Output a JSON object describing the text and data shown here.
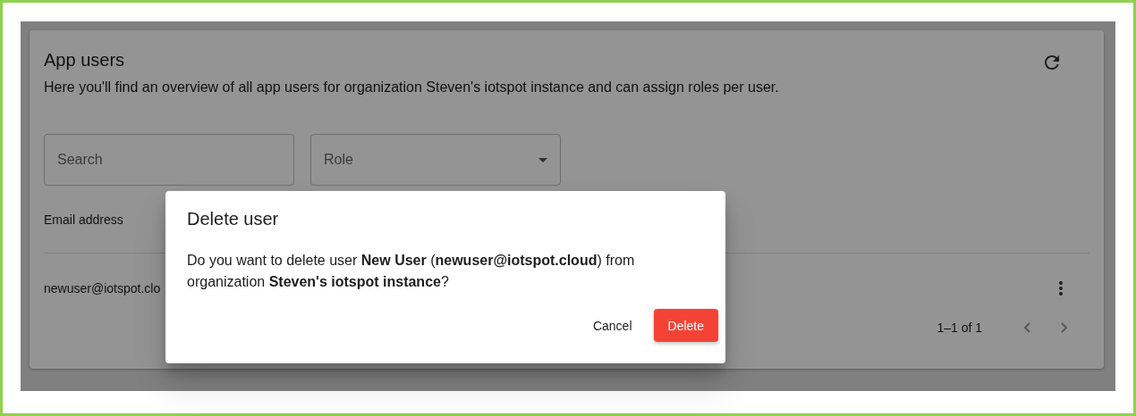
{
  "page": {
    "title": "App users",
    "description": "Here you'll find an overview of all app users for organization Steven's iotspot instance and can assign roles per user."
  },
  "filters": {
    "search": {
      "placeholder": "Search"
    },
    "role": {
      "placeholder": "Role"
    }
  },
  "table": {
    "columns": [
      "Email address"
    ],
    "rows": [
      {
        "email": "newuser@iotspot.clo"
      }
    ],
    "pagination": {
      "range": "1–1 of 1",
      "previous_disabled": true,
      "next_disabled": true
    }
  },
  "dialog": {
    "title": "Delete user",
    "message": "Do you want to delete user **New User** (**newuser@iotspot.cloud**) from organization **Steven's iotspot instance**?",
    "buttons": [
      {
        "label": "Cancel",
        "kind": "text"
      },
      {
        "label": "Delete",
        "kind": "primary"
      }
    ]
  }
}
